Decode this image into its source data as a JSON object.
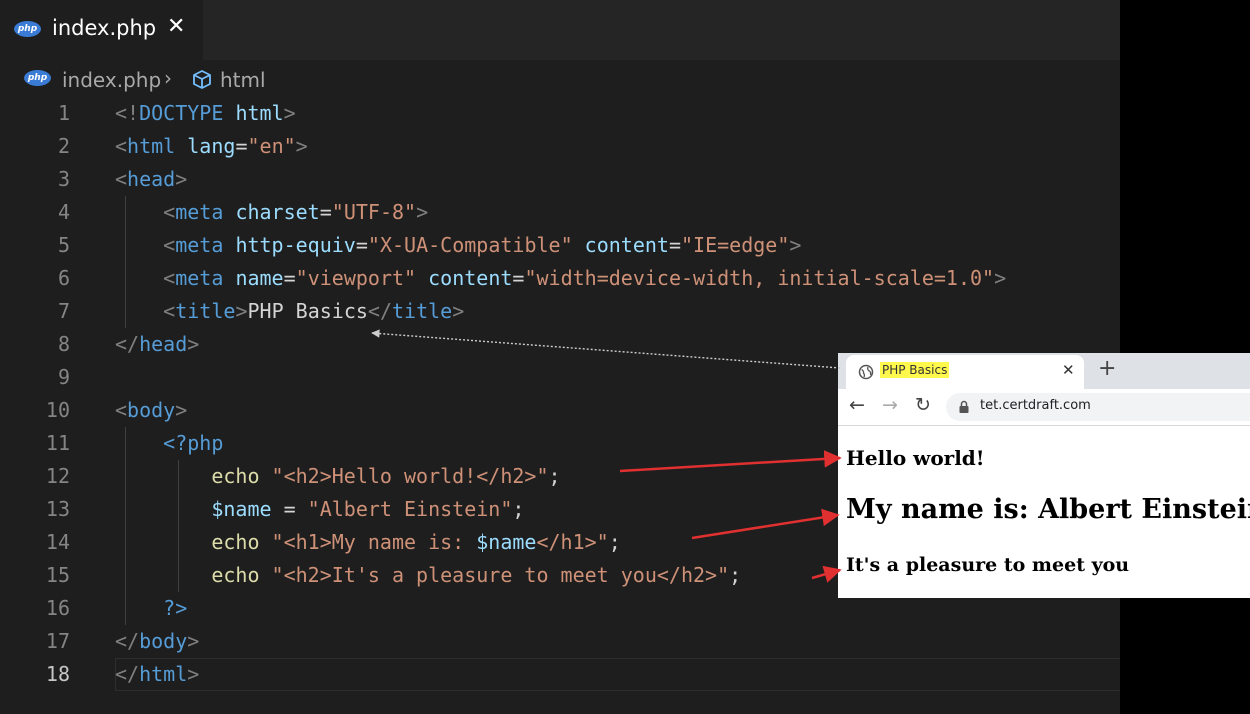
{
  "editor": {
    "tab": {
      "filename": "index.php",
      "close": "✕"
    },
    "breadcrumb": {
      "file": "index.php",
      "separator": "›",
      "node": "html"
    },
    "lines": [
      {
        "n": "1",
        "tokens": [
          [
            "br",
            "<!"
          ],
          [
            "tag",
            "DOCTYPE"
          ],
          [
            "txt",
            " "
          ],
          [
            "attr",
            "html"
          ],
          [
            "br",
            ">"
          ]
        ]
      },
      {
        "n": "2",
        "tokens": [
          [
            "br",
            "<"
          ],
          [
            "tag",
            "html"
          ],
          [
            "txt",
            " "
          ],
          [
            "attr",
            "lang"
          ],
          [
            "txt",
            "="
          ],
          [
            "str",
            "\"en\""
          ],
          [
            "br",
            ">"
          ]
        ]
      },
      {
        "n": "3",
        "tokens": [
          [
            "br",
            "<"
          ],
          [
            "tag",
            "head"
          ],
          [
            "br",
            ">"
          ]
        ]
      },
      {
        "n": "4",
        "tokens": [
          [
            "txt",
            "    "
          ],
          [
            "br",
            "<"
          ],
          [
            "tag",
            "meta"
          ],
          [
            "txt",
            " "
          ],
          [
            "attr",
            "charset"
          ],
          [
            "txt",
            "="
          ],
          [
            "str",
            "\"UTF-8\""
          ],
          [
            "br",
            ">"
          ]
        ]
      },
      {
        "n": "5",
        "tokens": [
          [
            "txt",
            "    "
          ],
          [
            "br",
            "<"
          ],
          [
            "tag",
            "meta"
          ],
          [
            "txt",
            " "
          ],
          [
            "attr",
            "http-equiv"
          ],
          [
            "txt",
            "="
          ],
          [
            "str",
            "\"X-UA-Compatible\""
          ],
          [
            "txt",
            " "
          ],
          [
            "attr",
            "content"
          ],
          [
            "txt",
            "="
          ],
          [
            "str",
            "\"IE=edge\""
          ],
          [
            "br",
            ">"
          ]
        ]
      },
      {
        "n": "6",
        "tokens": [
          [
            "txt",
            "    "
          ],
          [
            "br",
            "<"
          ],
          [
            "tag",
            "meta"
          ],
          [
            "txt",
            " "
          ],
          [
            "attr",
            "name"
          ],
          [
            "txt",
            "="
          ],
          [
            "str",
            "\"viewport\""
          ],
          [
            "txt",
            " "
          ],
          [
            "attr",
            "content"
          ],
          [
            "txt",
            "="
          ],
          [
            "str",
            "\"width=device-width, initial-scale=1.0\""
          ],
          [
            "br",
            ">"
          ]
        ]
      },
      {
        "n": "7",
        "tokens": [
          [
            "txt",
            "    "
          ],
          [
            "br",
            "<"
          ],
          [
            "tag",
            "title"
          ],
          [
            "br",
            ">"
          ],
          [
            "txt",
            "PHP Basics"
          ],
          [
            "br",
            "</"
          ],
          [
            "tag",
            "title"
          ],
          [
            "br",
            ">"
          ]
        ]
      },
      {
        "n": "8",
        "tokens": [
          [
            "br",
            "</"
          ],
          [
            "tag",
            "head"
          ],
          [
            "br",
            ">"
          ]
        ]
      },
      {
        "n": "9",
        "tokens": []
      },
      {
        "n": "10",
        "tokens": [
          [
            "br",
            "<"
          ],
          [
            "tag",
            "body"
          ],
          [
            "br",
            ">"
          ]
        ]
      },
      {
        "n": "11",
        "tokens": [
          [
            "txt",
            "    "
          ],
          [
            "tag",
            "<?php"
          ]
        ]
      },
      {
        "n": "12",
        "tokens": [
          [
            "txt",
            "        "
          ],
          [
            "kw",
            "echo"
          ],
          [
            "txt",
            " "
          ],
          [
            "str",
            "\"<h2>Hello world!</h2>\""
          ],
          [
            "txt",
            ";"
          ]
        ]
      },
      {
        "n": "13",
        "tokens": [
          [
            "txt",
            "        "
          ],
          [
            "var",
            "$name"
          ],
          [
            "txt",
            " = "
          ],
          [
            "str",
            "\"Albert Einstein\""
          ],
          [
            "txt",
            ";"
          ]
        ]
      },
      {
        "n": "14",
        "tokens": [
          [
            "txt",
            "        "
          ],
          [
            "kw",
            "echo"
          ],
          [
            "txt",
            " "
          ],
          [
            "str",
            "\"<h1>My name is: "
          ],
          [
            "var",
            "$name"
          ],
          [
            "str",
            "</h1>\""
          ],
          [
            "txt",
            ";"
          ]
        ]
      },
      {
        "n": "15",
        "tokens": [
          [
            "txt",
            "        "
          ],
          [
            "kw",
            "echo"
          ],
          [
            "txt",
            " "
          ],
          [
            "str",
            "\"<h2>It's a pleasure to meet you</h2>\""
          ],
          [
            "txt",
            ";"
          ]
        ]
      },
      {
        "n": "16",
        "tokens": [
          [
            "txt",
            "    "
          ],
          [
            "tag",
            "?>"
          ]
        ]
      },
      {
        "n": "17",
        "tokens": [
          [
            "br",
            "</"
          ],
          [
            "tag",
            "body"
          ],
          [
            "br",
            ">"
          ]
        ]
      },
      {
        "n": "18",
        "tokens": [
          [
            "br",
            "</"
          ],
          [
            "tag",
            "html"
          ],
          [
            "br",
            ">"
          ]
        ]
      }
    ]
  },
  "browser": {
    "tab_title": "PHP Basics",
    "tab_close": "✕",
    "new_tab": "+",
    "back": "←",
    "forward": "→",
    "reload": "↻",
    "url": "tet.certdraft.com",
    "content": {
      "h2_hello": "Hello world!",
      "h1_name": "My name is: Albert Einstein",
      "h2_pleasure": "It's a pleasure to meet you"
    }
  },
  "colors": {
    "editor_bg": "#1e1e1e",
    "tag": "#569cd6",
    "attr": "#9cdcfe",
    "string": "#ce9178",
    "keyword": "#dcdcaa",
    "arrow": "#e03030",
    "title_highlight": "#fff94d"
  }
}
